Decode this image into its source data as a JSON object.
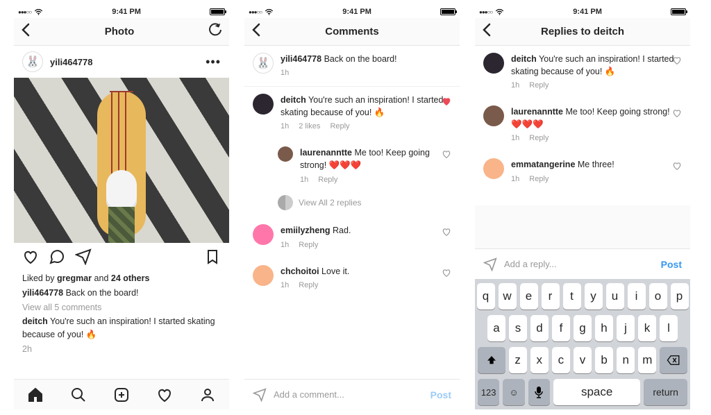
{
  "status": {
    "time": "9:41 PM"
  },
  "screen1": {
    "title": "Photo",
    "author": "yili464778",
    "likes_prefix": "Liked by ",
    "likes_user": "gregmar",
    "likes_and": " and ",
    "likes_others": "24 others",
    "caption_user": "yili464778",
    "caption_text": " Back on the board!",
    "view_all": "View all 5 comments",
    "comment_user": "deitch",
    "comment_text": " You're such an inspiration! I started skating because of you! 🔥",
    "time": "2h"
  },
  "screen2": {
    "title": "Comments",
    "post_label": "Post",
    "placeholder": "Add a comment...",
    "op": {
      "user": "yili464778",
      "text": " Back on the board!",
      "time": "1h"
    },
    "c1": {
      "user": "deitch",
      "text": " You're such an inspiration! I started skating because of you! 🔥",
      "time": "1h",
      "likes": "2 likes",
      "reply": "Reply"
    },
    "c2": {
      "user": "laurenanntte",
      "text": " Me too! Keep going strong! ❤️❤️❤️",
      "time": "1h",
      "reply": "Reply"
    },
    "viewreplies": "View All 2 replies",
    "c3": {
      "user": "emiilyzheng",
      "text": " Rad.",
      "time": "1h",
      "reply": "Reply"
    },
    "c4": {
      "user": "chchoitoi",
      "text": " Love it.",
      "time": "1h",
      "reply": "Reply"
    }
  },
  "screen3": {
    "title": "Replies to deitch",
    "post_label": "Post",
    "placeholder": "Add a reply...",
    "r1": {
      "user": "deitch",
      "text": " You're such an inspiration! I started skating because of you! 🔥",
      "time": "1h",
      "reply": "Reply"
    },
    "r2": {
      "user": "laurenanntte",
      "text": " Me too! Keep going strong! ❤️❤️❤️",
      "time": "1h",
      "reply": "Reply"
    },
    "r3": {
      "user": "emmatangerine",
      "text": " Me three!",
      "time": "1h",
      "reply": "Reply"
    }
  },
  "keyboard": {
    "row1": [
      "q",
      "w",
      "e",
      "r",
      "t",
      "y",
      "u",
      "i",
      "o",
      "p"
    ],
    "row2": [
      "a",
      "s",
      "d",
      "f",
      "g",
      "h",
      "j",
      "k",
      "l"
    ],
    "row3": [
      "z",
      "x",
      "c",
      "v",
      "b",
      "n",
      "m"
    ],
    "numkey": "123",
    "emoji": "😀",
    "mic": "🎤",
    "space": "space",
    "return": "return"
  }
}
